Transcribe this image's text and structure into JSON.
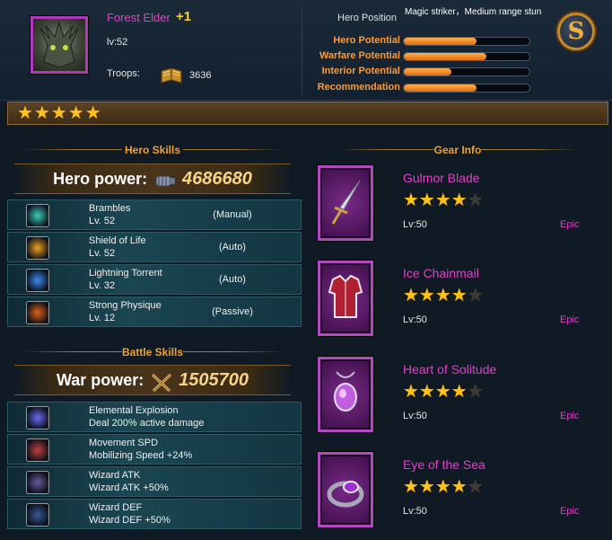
{
  "hero": {
    "name": "Forest Elder",
    "plus": "+1",
    "level": "lv:52",
    "troops_label": "Troops:",
    "troops_value": "3636",
    "stars": "★★★★★"
  },
  "position": {
    "label": "Hero Position",
    "value": "Magic striker，Medium range stun"
  },
  "potentials": [
    {
      "label": "Hero Potential",
      "level": 0.58
    },
    {
      "label": "Warfare Potential",
      "level": 0.66
    },
    {
      "label": "Interior Potential",
      "level": 0.38
    },
    {
      "label": "Recommendation",
      "level": 0.58
    }
  ],
  "hero_skills": {
    "title": "Hero Skills",
    "power_label": "Hero power:",
    "power_value": "4686680",
    "items": [
      {
        "name": "Brambles",
        "level": "Lv. 52",
        "mode": "(Manual)",
        "color": "#3fd0c0"
      },
      {
        "name": "Shield of Life",
        "level": "Lv. 52",
        "mode": "(Auto)",
        "color": "#f0a020"
      },
      {
        "name": "Lightning Torrent",
        "level": "Lv. 32",
        "mode": "(Auto)",
        "color": "#3a8af0"
      },
      {
        "name": "Strong Physique",
        "level": "Lv. 12",
        "mode": "(Passive)",
        "color": "#e06018"
      }
    ]
  },
  "battle_skills": {
    "title": "Battle Skills",
    "power_label": "War power:",
    "power_value": "1505700",
    "items": [
      {
        "name": "Elemental Explosion",
        "desc": "Deal 200% active damage",
        "color": "#6a6af0"
      },
      {
        "name": "Movement SPD",
        "desc": "Mobilizing Speed +24%",
        "color": "#c04040"
      },
      {
        "name": "Wizard ATK",
        "desc": "Wizard ATK +50%",
        "color": "#6a5a9a"
      },
      {
        "name": "Wizard DEF",
        "desc": "Wizard DEF +50%",
        "color": "#3a5a9a"
      }
    ]
  },
  "gear": {
    "title": "Gear Info",
    "items": [
      {
        "name": "Gulmor Blade",
        "level": "Lv:50",
        "rarity": "Epic",
        "stars": 4,
        "icon": "sword-icon"
      },
      {
        "name": "Ice Chainmail",
        "level": "Lv:50",
        "rarity": "Epic",
        "stars": 4,
        "icon": "armor-icon"
      },
      {
        "name": "Heart of Solitude",
        "level": "Lv:50",
        "rarity": "Epic",
        "stars": 4,
        "icon": "amulet-icon"
      },
      {
        "name": "Eye of the Sea",
        "level": "Lv:50",
        "rarity": "Epic",
        "stars": 4,
        "icon": "ring-icon"
      }
    ]
  },
  "colors": {
    "accent": "#e040c8",
    "gold": "#ffc21a",
    "orange": "#f0a030"
  }
}
